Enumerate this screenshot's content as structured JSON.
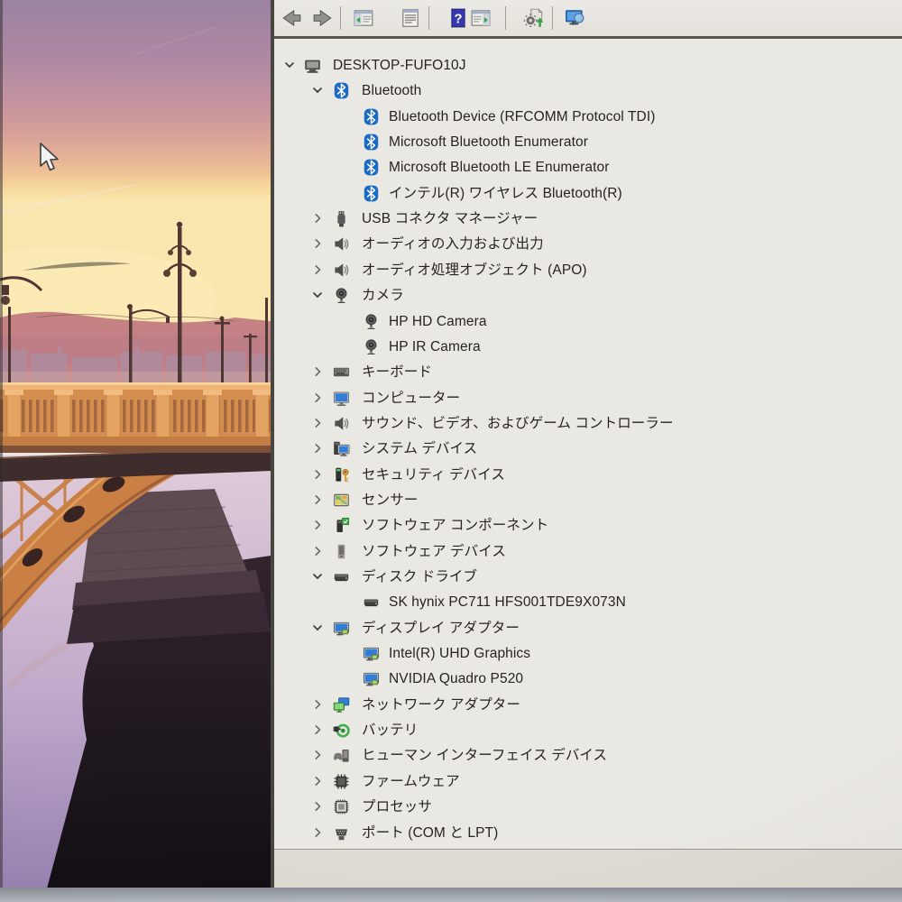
{
  "desktop": {
    "cursor_icon": "arrow-cursor-icon",
    "wallpaper": {
      "scene": "sunset-bridge",
      "colors": {
        "sky_top": "#98809f",
        "sky_pink": "#d29b97",
        "sky_gold": "#f7da9c",
        "hills": "#c47f82",
        "bridge_orange": "#d28c4c",
        "arch_orange": "#c97e41",
        "water_light": "#c3abcc",
        "water_dark": "#140e15"
      }
    }
  },
  "window": {
    "toolbar": {
      "items": [
        {
          "type": "button",
          "name": "back",
          "icon": "back-icon"
        },
        {
          "type": "button",
          "name": "forward",
          "icon": "forward-icon"
        },
        {
          "type": "separator"
        },
        {
          "type": "button",
          "name": "show-console-tree",
          "icon": "console-tree-icon"
        },
        {
          "type": "button",
          "name": "properties",
          "icon": "properties-icon"
        },
        {
          "type": "separator"
        },
        {
          "type": "button",
          "name": "help",
          "icon": "help-icon"
        },
        {
          "type": "button",
          "name": "action-pane",
          "icon": "action-pane-icon"
        },
        {
          "type": "separator"
        },
        {
          "type": "button",
          "name": "update-driver",
          "icon": "update-driver-icon"
        },
        {
          "type": "separator"
        },
        {
          "type": "button",
          "name": "scan-hardware-changes",
          "icon": "scan-hardware-icon"
        }
      ]
    },
    "tree": {
      "items": [
        {
          "label": "DESKTOP-FUFO10J",
          "level": 0,
          "expand": "expanded",
          "icon": "computer-icon"
        },
        {
          "label": "Bluetooth",
          "level": 1,
          "expand": "expanded",
          "icon": "bluetooth-icon"
        },
        {
          "label": "Bluetooth Device (RFCOMM Protocol TDI)",
          "level": 2,
          "expand": "leaf",
          "icon": "bluetooth-icon"
        },
        {
          "label": "Microsoft Bluetooth Enumerator",
          "level": 2,
          "expand": "leaf",
          "icon": "bluetooth-icon"
        },
        {
          "label": "Microsoft Bluetooth LE Enumerator",
          "level": 2,
          "expand": "leaf",
          "icon": "bluetooth-icon"
        },
        {
          "label": "インテル(R) ワイヤレス Bluetooth(R)",
          "level": 2,
          "expand": "leaf",
          "icon": "bluetooth-icon"
        },
        {
          "label": "USB コネクタ マネージャー",
          "level": 1,
          "expand": "collapsed",
          "icon": "usb-icon"
        },
        {
          "label": "オーディオの入力および出力",
          "level": 1,
          "expand": "collapsed",
          "icon": "speaker-icon"
        },
        {
          "label": "オーディオ処理オブジェクト (APO)",
          "level": 1,
          "expand": "collapsed",
          "icon": "speaker-icon"
        },
        {
          "label": "カメラ",
          "level": 1,
          "expand": "expanded",
          "icon": "camera-icon"
        },
        {
          "label": "HP HD Camera",
          "level": 2,
          "expand": "leaf",
          "icon": "camera-icon"
        },
        {
          "label": "HP IR Camera",
          "level": 2,
          "expand": "leaf",
          "icon": "camera-icon"
        },
        {
          "label": "キーボード",
          "level": 1,
          "expand": "collapsed",
          "icon": "keyboard-icon"
        },
        {
          "label": "コンピューター",
          "level": 1,
          "expand": "collapsed",
          "icon": "monitor-icon"
        },
        {
          "label": "サウンド、ビデオ、およびゲーム コントローラー",
          "level": 1,
          "expand": "collapsed",
          "icon": "speaker-icon"
        },
        {
          "label": "システム デバイス",
          "level": 1,
          "expand": "collapsed",
          "icon": "system-devices-icon"
        },
        {
          "label": "セキュリティ デバイス",
          "level": 1,
          "expand": "collapsed",
          "icon": "security-key-icon"
        },
        {
          "label": "センサー",
          "level": 1,
          "expand": "collapsed",
          "icon": "sensor-icon"
        },
        {
          "label": "ソフトウェア コンポーネント",
          "level": 1,
          "expand": "collapsed",
          "icon": "software-component-icon"
        },
        {
          "label": "ソフトウェア デバイス",
          "level": 1,
          "expand": "collapsed",
          "icon": "software-device-icon"
        },
        {
          "label": "ディスク ドライブ",
          "level": 1,
          "expand": "expanded",
          "icon": "disk-drive-icon"
        },
        {
          "label": "SK hynix PC711 HFS001TDE9X073N",
          "level": 2,
          "expand": "leaf",
          "icon": "disk-drive-icon"
        },
        {
          "label": "ディスプレイ アダプター",
          "level": 1,
          "expand": "expanded",
          "icon": "display-adapter-icon"
        },
        {
          "label": "Intel(R) UHD Graphics",
          "level": 2,
          "expand": "leaf",
          "icon": "display-adapter-icon"
        },
        {
          "label": "NVIDIA Quadro P520",
          "level": 2,
          "expand": "leaf",
          "icon": "display-adapter-icon"
        },
        {
          "label": "ネットワーク アダプター",
          "level": 1,
          "expand": "collapsed",
          "icon": "network-adapter-icon"
        },
        {
          "label": "バッテリ",
          "level": 1,
          "expand": "collapsed",
          "icon": "battery-icon"
        },
        {
          "label": "ヒューマン インターフェイス デバイス",
          "level": 1,
          "expand": "collapsed",
          "icon": "hid-icon"
        },
        {
          "label": "ファームウェア",
          "level": 1,
          "expand": "collapsed",
          "icon": "firmware-icon"
        },
        {
          "label": "プロセッサ",
          "level": 1,
          "expand": "collapsed",
          "icon": "processor-icon"
        },
        {
          "label": "ポート (COM と LPT)",
          "level": 1,
          "expand": "collapsed",
          "icon": "port-icon"
        },
        {
          "label": "",
          "level": 1,
          "expand": "collapsed",
          "icon": "partial-device-icon"
        }
      ]
    }
  }
}
